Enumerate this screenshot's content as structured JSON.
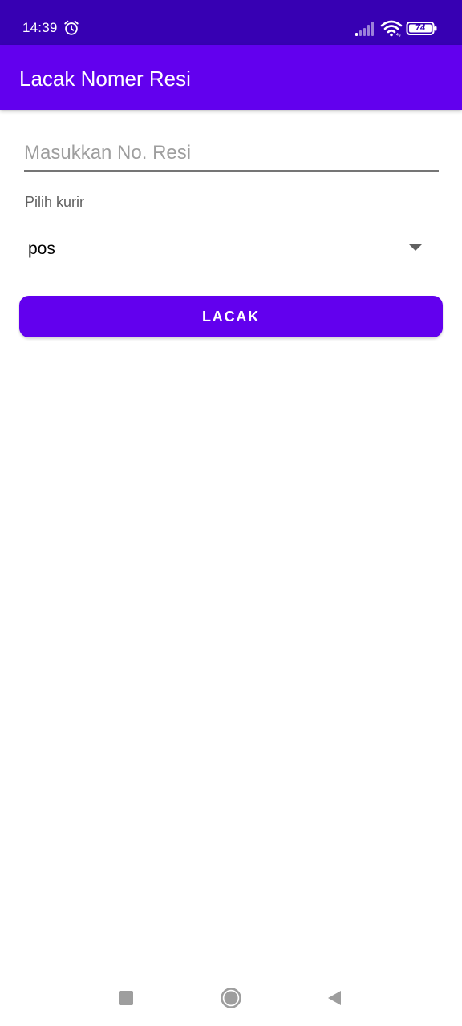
{
  "status_bar": {
    "time": "14:39",
    "battery_level": "74",
    "icons": [
      "alarm-icon",
      "signal-icon",
      "wifi-icon",
      "battery-icon"
    ]
  },
  "app_bar": {
    "title": "Lacak Nomer Resi"
  },
  "form": {
    "resi_input": {
      "placeholder": "Masukkan No. Resi",
      "value": ""
    },
    "courier_label": "Pilih kurir",
    "courier_selected": "pos",
    "track_button_label": "LACAK"
  },
  "nav_bar": {
    "icons": [
      "recent-apps-icon",
      "home-icon",
      "back-icon"
    ]
  },
  "colors": {
    "status_bar": "#3700b3",
    "primary": "#6200ee",
    "text_primary": "#000000",
    "text_secondary": "#616161",
    "hint": "#9e9e9e"
  }
}
